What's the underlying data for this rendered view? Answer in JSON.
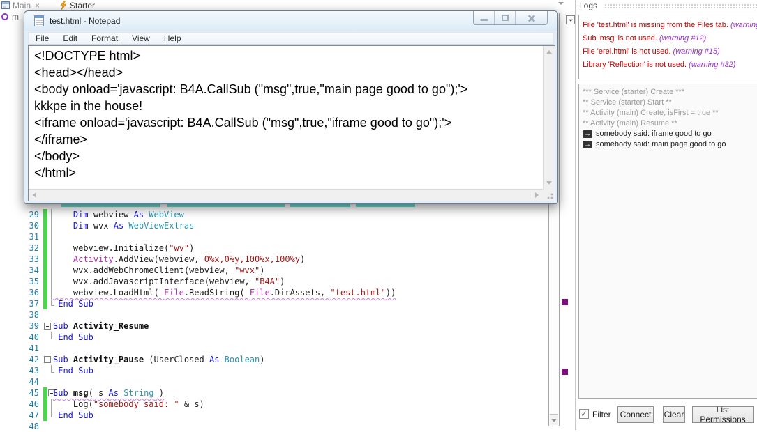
{
  "colors": {
    "keyword_blue": "#1414E0",
    "type_teal": "#2B91AF",
    "object_purple": "#AF30AF",
    "literal_maroon": "#A31515",
    "line_number_teal": "#1E7FA8",
    "green_change_bar": "#4FD44F",
    "cyan_highlight": "#64E3D4",
    "wavy_underline_purple": "#C080D0",
    "annotation_purple": "#7D0E7D",
    "warning_red": "#C80000",
    "warning_purple": "#9932CC",
    "log_gray": "#9A9A9A"
  },
  "ide": {
    "tabs": [
      {
        "label": "Main",
        "icon": "form-icon",
        "closable": true,
        "close_glyph": "×"
      },
      {
        "label": "Starter",
        "icon": "lightning-icon",
        "closable": false
      }
    ],
    "module_partial_label": "m"
  },
  "notepad": {
    "title": "test.html - Notepad",
    "menu": [
      "File",
      "Edit",
      "Format",
      "View",
      "Help"
    ],
    "lines": [
      "<!DOCTYPE html>",
      "<head></head>",
      "<body onload='javascript: B4A.CallSub (\"msg\",true,\"main page good to go\");'>",
      "kkkpe in the house!",
      "<iframe onload='javascript: B4A.CallSub (\"msg\",true,\"iframe good to go\");'>",
      "</iframe>",
      "</body>",
      "</html>"
    ]
  },
  "editor": {
    "lines": [
      {
        "n": 29,
        "ind": 4,
        "green": true,
        "rail": "mid",
        "tokens": [
          [
            "Dim ",
            "kw"
          ],
          [
            "webview ",
            "pl"
          ],
          [
            "As ",
            "kw"
          ],
          [
            "WebView",
            "ty"
          ]
        ]
      },
      {
        "n": 30,
        "ind": 4,
        "green": true,
        "rail": "mid",
        "tokens": [
          [
            "Dim ",
            "kw"
          ],
          [
            "wvx ",
            "pl"
          ],
          [
            "As ",
            "kw"
          ],
          [
            "WebViewExtras",
            "ty"
          ]
        ]
      },
      {
        "n": 31,
        "ind": 0,
        "green": true,
        "rail": "mid",
        "tokens": []
      },
      {
        "n": 32,
        "ind": 4,
        "green": true,
        "rail": "mid",
        "tokens": [
          [
            "webview.Initialize(",
            "pl"
          ],
          [
            "\"wv\"",
            "st"
          ],
          [
            ")",
            "pl"
          ]
        ]
      },
      {
        "n": 33,
        "ind": 4,
        "green": true,
        "rail": "mid",
        "tokens": [
          [
            "Activity",
            "ob"
          ],
          [
            ".AddView(webview, ",
            "pl"
          ],
          [
            "0%x,0%y,100%x,100%y",
            "nu"
          ],
          [
            ")",
            "pl"
          ]
        ]
      },
      {
        "n": 34,
        "ind": 4,
        "green": true,
        "rail": "mid",
        "tokens": [
          [
            "wvx.addWebChromeClient(webview, ",
            "pl"
          ],
          [
            "\"wvx\"",
            "st"
          ],
          [
            ")",
            "pl"
          ]
        ]
      },
      {
        "n": 35,
        "ind": 4,
        "green": true,
        "rail": "mid",
        "tokens": [
          [
            "wvx.addJavascriptInterface(webview, ",
            "pl"
          ],
          [
            "\"B4A\"",
            "st"
          ],
          [
            ")",
            "pl"
          ]
        ]
      },
      {
        "n": 36,
        "ind": 4,
        "green": true,
        "rail": "mid",
        "wavy": true,
        "tokens": [
          [
            "webview.LoadHtml( ",
            "pl"
          ],
          [
            "File",
            "ob"
          ],
          [
            ".ReadString( ",
            "pl"
          ],
          [
            "File",
            "ob"
          ],
          [
            ".DirAssets, ",
            "pl"
          ],
          [
            "\"test.html\"",
            "st"
          ],
          [
            "))",
            "pl"
          ]
        ]
      },
      {
        "n": 37,
        "ind": 1,
        "green": true,
        "rail": "end",
        "tokens": [
          [
            "End Sub",
            "kw"
          ]
        ]
      },
      {
        "n": 38,
        "ind": 0,
        "tokens": []
      },
      {
        "n": 39,
        "ind": 0,
        "box": true,
        "tokens": [
          [
            "Sub ",
            "kw"
          ],
          [
            "Activity_Resume",
            "bd"
          ]
        ]
      },
      {
        "n": 40,
        "ind": 1,
        "rail": "end",
        "tokens": [
          [
            "End Sub",
            "kw"
          ]
        ]
      },
      {
        "n": 41,
        "ind": 0,
        "tokens": []
      },
      {
        "n": 42,
        "ind": 0,
        "box": true,
        "tokens": [
          [
            "Sub ",
            "kw"
          ],
          [
            "Activity_Pause ",
            "bd"
          ],
          [
            "(UserClosed ",
            "pl"
          ],
          [
            "As ",
            "kw"
          ],
          [
            "Boolean",
            "ty"
          ],
          [
            ")",
            "pl"
          ]
        ]
      },
      {
        "n": 43,
        "ind": 1,
        "rail": "end",
        "tokens": [
          [
            "End Sub",
            "kw"
          ]
        ]
      },
      {
        "n": 44,
        "ind": 0,
        "tokens": []
      },
      {
        "n": 45,
        "ind": 0,
        "green": true,
        "box": true,
        "wavy": true,
        "tokens": [
          [
            "Sub ",
            "kw"
          ],
          [
            "msg",
            "bd"
          ],
          [
            "( s ",
            "pl"
          ],
          [
            "As ",
            "kw"
          ],
          [
            "String",
            "ty"
          ],
          [
            " )",
            "pl"
          ]
        ]
      },
      {
        "n": 46,
        "ind": 4,
        "green": true,
        "rail": "mid",
        "tokens": [
          [
            "Log(",
            "pl"
          ],
          [
            "\"somebody said: \"",
            "st"
          ],
          [
            " & s)",
            "pl"
          ]
        ]
      },
      {
        "n": 47,
        "ind": 1,
        "green": true,
        "rail": "end",
        "tokens": [
          [
            "End Sub",
            "kw"
          ]
        ]
      },
      {
        "n": 48,
        "ind": 0,
        "tokens": []
      }
    ]
  },
  "logs": {
    "title": "Logs",
    "warnings": [
      {
        "text": "File 'test.html' is missing from the Files tab. ",
        "note": "(warning"
      },
      {
        "text": "Sub 'msg' is not used. ",
        "note": "(warning #12)"
      },
      {
        "text": "File 'erel.html' is not used. ",
        "note": "(warning #15)"
      },
      {
        "text": "Library 'Reflection' is not used. ",
        "note": "(warning #32)"
      }
    ],
    "entries": [
      {
        "text": "*** Service (starter) Create ***",
        "kind": "info"
      },
      {
        "text": "** Service (starter) Start **",
        "kind": "info"
      },
      {
        "text": "** Activity (main) Create, isFirst = true **",
        "kind": "info"
      },
      {
        "text": "** Activity (main) Resume **",
        "kind": "info"
      },
      {
        "text": "somebody said: iframe good to go",
        "kind": "message",
        "icon": "arrow-right-badge-icon",
        "icon_glyph": "→"
      },
      {
        "text": "somebody said: main page good to go",
        "kind": "message",
        "icon": "arrow-right-badge-icon",
        "icon_glyph": "→"
      }
    ],
    "controls": {
      "filter_label": "Filter",
      "filter_checked": true,
      "check_glyph": "✓",
      "buttons": [
        "Connect",
        "Clear",
        "List Permissions"
      ]
    }
  }
}
